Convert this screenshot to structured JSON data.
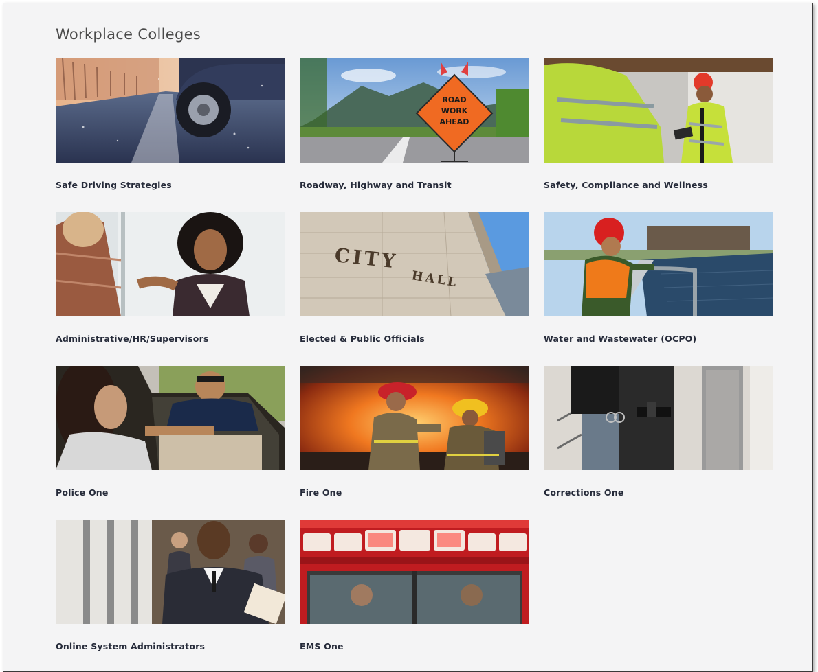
{
  "section": {
    "title": "Workplace Colleges"
  },
  "cards": [
    {
      "label": "Safe Driving Strategies",
      "icon": "car-tire-on-road-image"
    },
    {
      "label": "Roadway, Highway and Transit",
      "icon": "road-work-sign-image",
      "sign_text": [
        "ROAD",
        "WORK",
        "AHEAD"
      ]
    },
    {
      "label": "Safety, Compliance and Wellness",
      "icon": "safety-workers-image"
    },
    {
      "label": "Administrative/HR/Supervisors",
      "icon": "handshake-image"
    },
    {
      "label": "Elected & Public Officials",
      "icon": "city-hall-image",
      "sign_text": [
        "CITY",
        "HALL"
      ]
    },
    {
      "label": "Water and Wastewater (OCPO)",
      "icon": "water-treatment-worker-image"
    },
    {
      "label": "Police One",
      "icon": "police-traffic-stop-image"
    },
    {
      "label": "Fire One",
      "icon": "firefighters-image"
    },
    {
      "label": "Corrections One",
      "icon": "corrections-officer-image"
    },
    {
      "label": "Online System Administrators",
      "icon": "business-man-image"
    },
    {
      "label": "EMS One",
      "icon": "ambulance-image"
    }
  ],
  "colors": {
    "panel_background": "#f4f4f5",
    "label_text": "#262b3a",
    "title_text": "#4a4a4a"
  }
}
